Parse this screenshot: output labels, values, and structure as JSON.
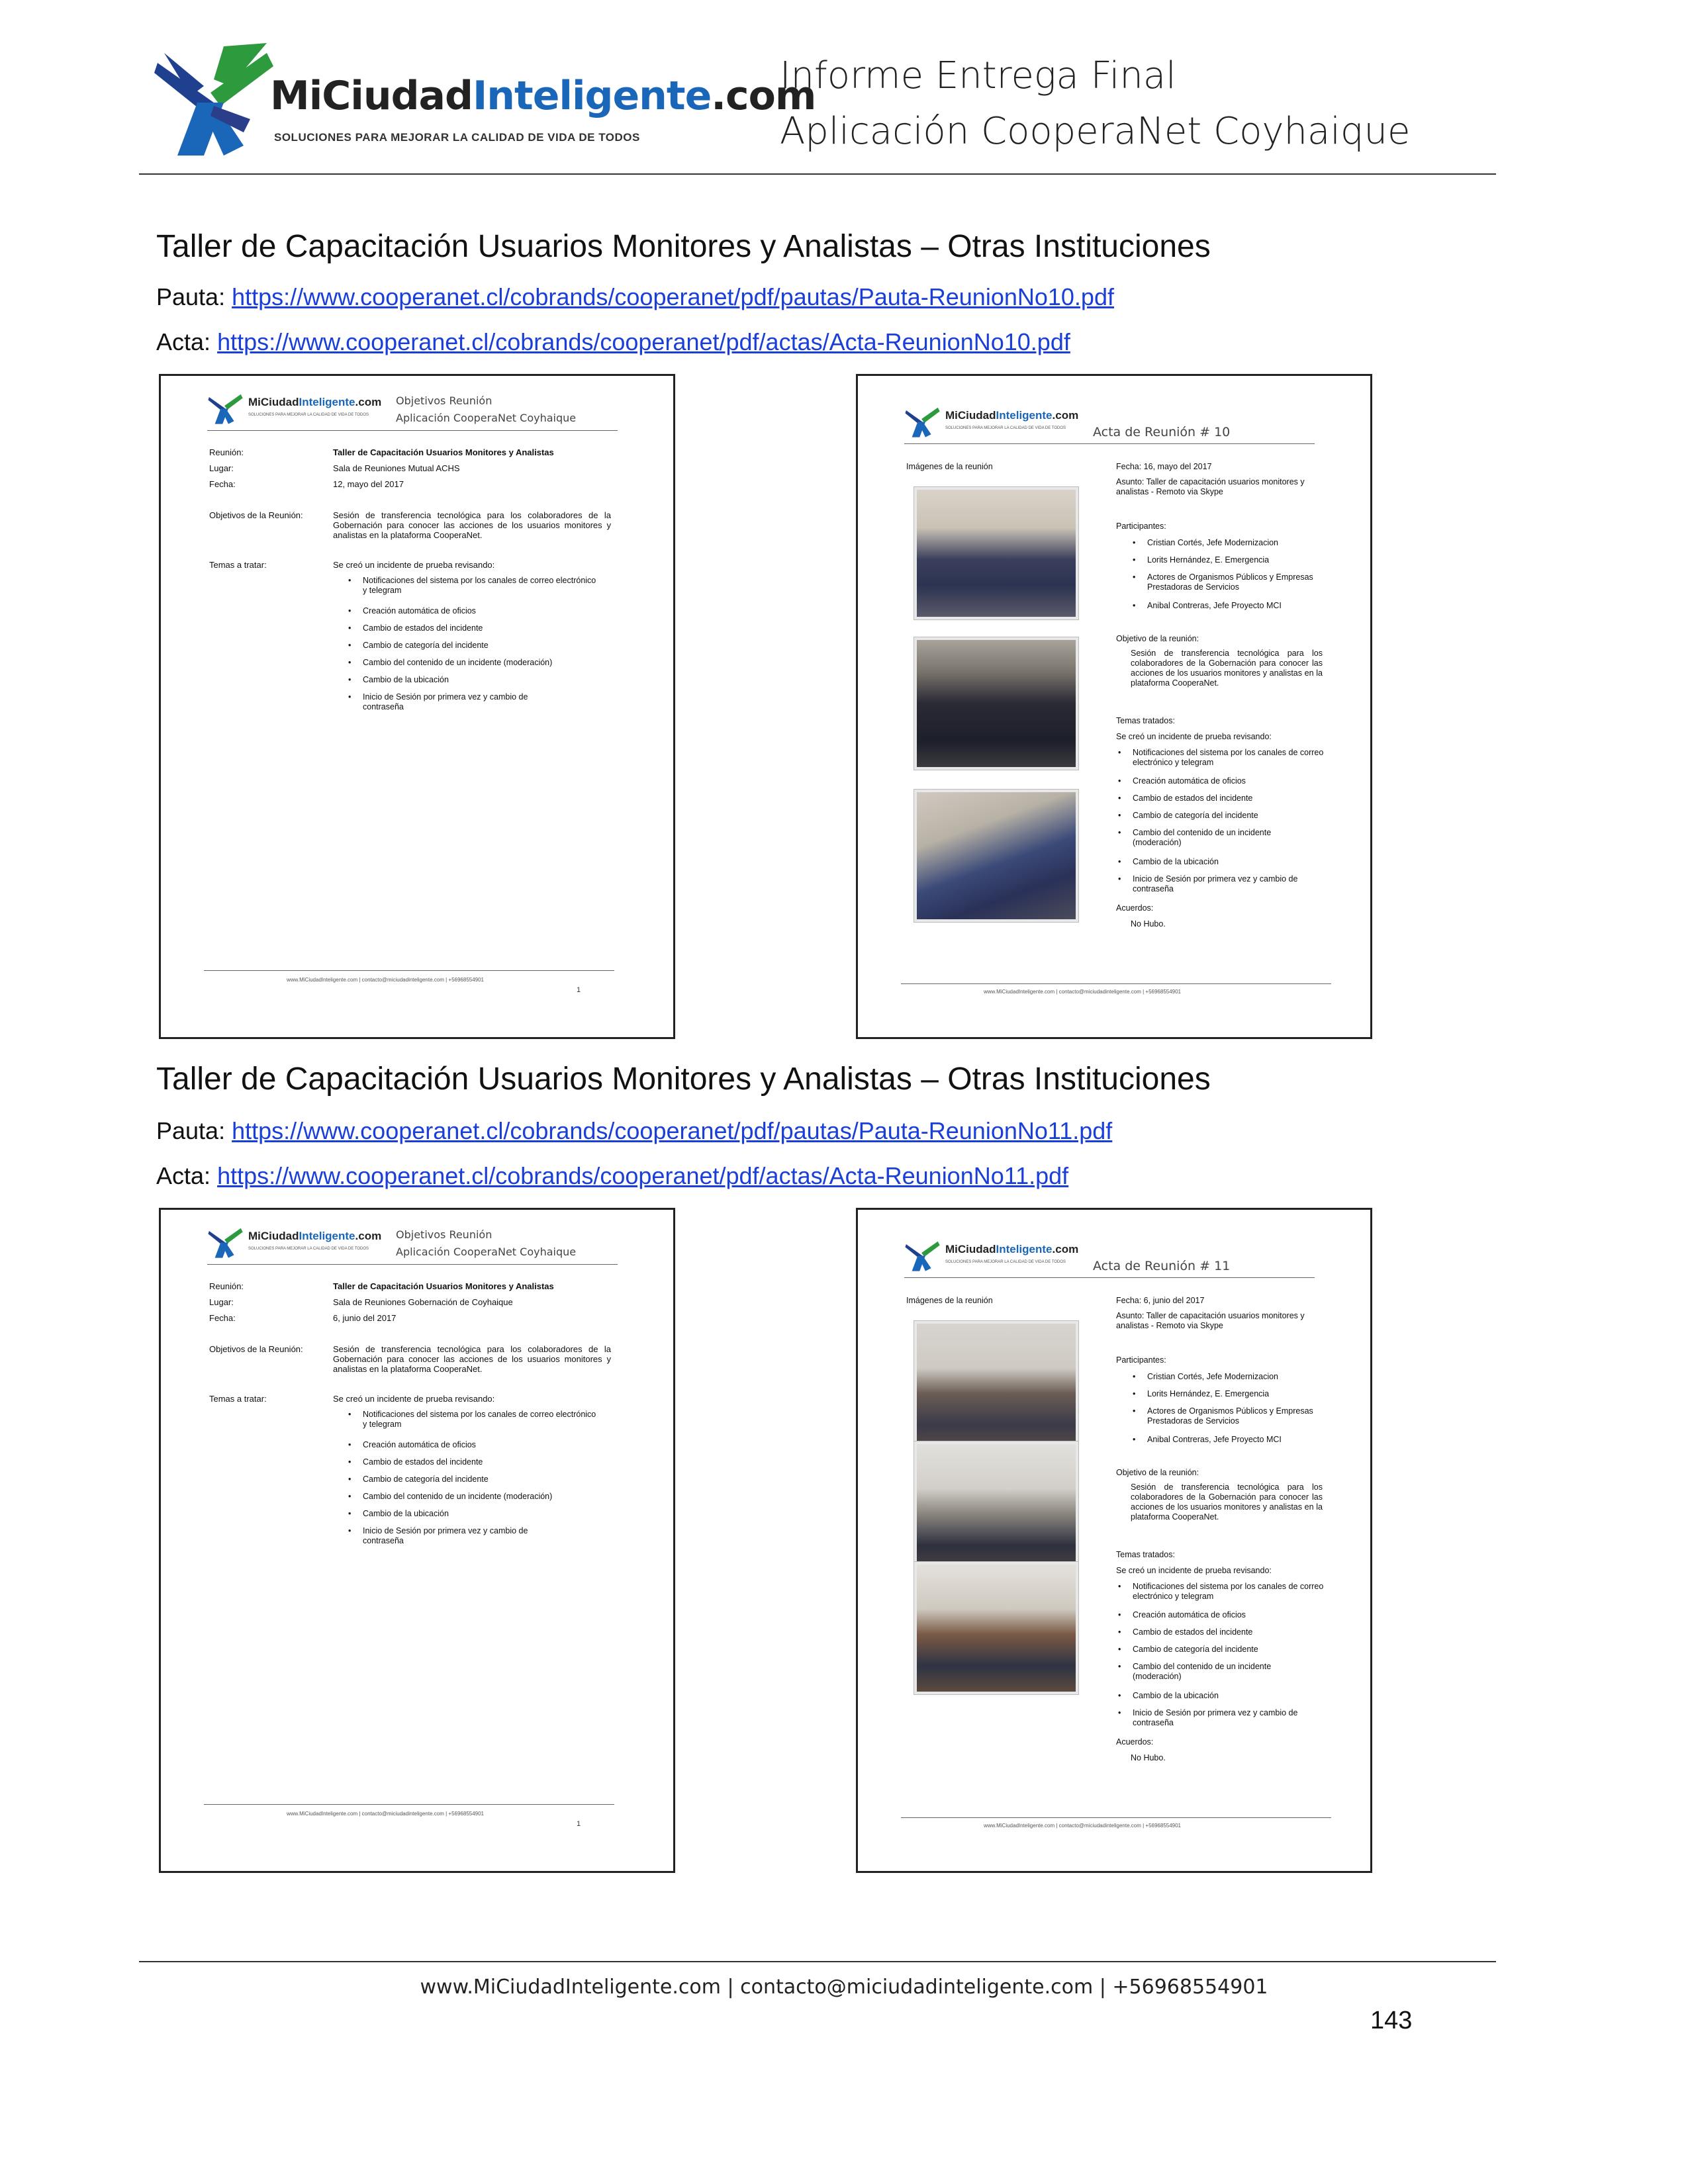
{
  "header": {
    "logo_text_mi": "MiCiudad",
    "logo_text_intel": "Inteligente",
    "logo_text_com": ".com",
    "logo_tagline": "SOLUCIONES PARA MEJORAR LA CALIDAD DE VIDA DE TODOS",
    "title_line1": "Informe Entrega Final",
    "title_line2": "Aplicación CooperaNet Coyhaique"
  },
  "sections": [
    {
      "title": "Taller de Capacitación Usuarios Monitores y Analistas – Otras Instituciones",
      "pauta_label": "Pauta:",
      "pauta_url": "https://www.cooperanet.cl/cobrands/cooperanet/pdf/pautas/Pauta-ReunionNo10.pdf",
      "acta_label": "Acta:",
      "acta_url": "https://www.cooperanet.cl/cobrands/cooperanet/pdf/actas/Acta-ReunionNo10.pdf",
      "pauta_doc": {
        "head1": "Objetivos Reunión",
        "head2": "Aplicación CooperaNet Coyhaique",
        "reunion_label": "Reunión:",
        "reunion": "Taller de Capacitación Usuarios Monitores y Analistas",
        "lugar_label": "Lugar:",
        "lugar": "Sala de Reuniones Mutual ACHS",
        "fecha_label": "Fecha:",
        "fecha": "12, mayo del 2017",
        "objetivos_label": "Objetivos de la Reunión:",
        "objetivos": "Sesión de transferencia tecnológica para los colaboradores de la Gobernación para conocer las acciones de los usuarios monitores y analistas en la plataforma CooperaNet.",
        "temas_label": "Temas a tratar:",
        "temas_intro": "Se creó un incidente de prueba revisando:",
        "temas": [
          "Notificaciones del sistema por los canales de correo electrónico y telegram",
          "Creación automática de oficios",
          "Cambio de estados del incidente",
          "Cambio de categoría del incidente",
          "Cambio del contenido de un incidente (moderación)",
          "Cambio de la ubicación",
          "Inicio de Sesión por primera vez y cambio de contraseña"
        ],
        "footer": "www.MiCiudadInteligente.com | contacto@miciudadinteligente.com | +56968554901",
        "page": "1"
      },
      "acta_doc": {
        "head": "Acta de Reunión # 10",
        "imagenes_label": "Imágenes de la reunión",
        "fecha": "Fecha: 16, mayo del 2017",
        "asunto": "Asunto: Taller de capacitación usuarios monitores y analistas - Remoto via Skype",
        "participantes_label": "Participantes:",
        "participantes": [
          "Cristian Cortés, Jefe Modernizacion",
          "Lorits Hernández, E. Emergencia",
          "Actores de Organismos Públicos y Empresas Prestadoras de Servicios",
          "Anibal Contreras, Jefe Proyecto MCI"
        ],
        "objetivo_label": "Objetivo de la reunión:",
        "objetivo": "Sesión de transferencia tecnológica para los colaboradores de la Gobernación para conocer las acciones de los usuarios monitores y analistas en la plataforma CooperaNet.",
        "temas_label": "Temas tratados:",
        "temas_intro": "Se creó un incidente de prueba revisando:",
        "temas": [
          "Notificaciones del sistema por los canales de correo electrónico y telegram",
          "Creación automática de oficios",
          "Cambio de estados del incidente",
          "Cambio de categoría del incidente",
          "Cambio del contenido de un incidente (moderación)",
          "Cambio de la ubicación",
          "Inicio de Sesión por primera vez y cambio de contraseña"
        ],
        "acuerdos_label": "Acuerdos:",
        "acuerdos": "No Hubo.",
        "footer": "www.MiCiudadInteligente.com | contacto@miciudadinteligente.com | +56968554901"
      }
    },
    {
      "title": "Taller de Capacitación Usuarios Monitores y Analistas – Otras Instituciones",
      "pauta_label": "Pauta:",
      "pauta_url": "https://www.cooperanet.cl/cobrands/cooperanet/pdf/pautas/Pauta-ReunionNo11.pdf",
      "acta_label": "Acta:",
      "acta_url": "https://www.cooperanet.cl/cobrands/cooperanet/pdf/actas/Acta-ReunionNo11.pdf",
      "pauta_doc": {
        "head1": "Objetivos Reunión",
        "head2": "Aplicación CooperaNet Coyhaique",
        "reunion_label": "Reunión:",
        "reunion": "Taller de Capacitación Usuarios Monitores y Analistas",
        "lugar_label": "Lugar:",
        "lugar": "Sala de Reuniones Gobernación de Coyhaique",
        "fecha_label": "Fecha:",
        "fecha": "6, junio del 2017",
        "objetivos_label": "Objetivos de la Reunión:",
        "objetivos": "Sesión de transferencia tecnológica para los colaboradores de la Gobernación para conocer las acciones de los usuarios monitores y analistas en la plataforma CooperaNet.",
        "temas_label": "Temas a tratar:",
        "temas_intro": "Se creó un incidente de prueba revisando:",
        "temas": [
          "Notificaciones del sistema por los canales de correo electrónico y telegram",
          "Creación automática de oficios",
          "Cambio de estados del incidente",
          "Cambio de categoría del incidente",
          "Cambio del contenido de un incidente (moderación)",
          "Cambio de la ubicación",
          "Inicio de Sesión por primera vez y cambio de contraseña"
        ],
        "footer": "www.MiCiudadInteligente.com | contacto@miciudadinteligente.com | +56968554901",
        "page": "1"
      },
      "acta_doc": {
        "head": "Acta de Reunión # 11",
        "imagenes_label": "Imágenes de la reunión",
        "fecha": "Fecha: 6, junio del 2017",
        "asunto": "Asunto: Taller de capacitación usuarios monitores y analistas - Remoto via Skype",
        "participantes_label": "Participantes:",
        "participantes": [
          "Cristian Cortés, Jefe Modernizacion",
          "Lorits Hernández, E. Emergencia",
          "Actores de Organismos Públicos y Empresas Prestadoras de Servicios",
          "Anibal Contreras, Jefe Proyecto MCI"
        ],
        "objetivo_label": "Objetivo de la reunión:",
        "objetivo": "Sesión de transferencia tecnológica para los colaboradores de la Gobernación para conocer las acciones de los usuarios monitores y analistas en la plataforma CooperaNet.",
        "temas_label": "Temas tratados:",
        "temas_intro": "Se creó un incidente de prueba revisando:",
        "temas": [
          "Notificaciones del sistema por los canales de correo electrónico y telegram",
          "Creación automática de oficios",
          "Cambio de estados del incidente",
          "Cambio de categoría del incidente",
          "Cambio del contenido de un incidente (moderación)",
          "Cambio de la ubicación",
          "Inicio de Sesión por primera vez y cambio de contraseña"
        ],
        "acuerdos_label": "Acuerdos:",
        "acuerdos": "No Hubo.",
        "footer": "www.MiCiudadInteligente.com | contacto@miciudadinteligente.com | +56968554901"
      }
    }
  ],
  "footer": {
    "text": "www.MiCiudadInteligente.com | contacto@miciudadinteligente.com | +56968554901",
    "page_number": "143"
  },
  "colors": {
    "link": "#1a3fd9",
    "brand_blue": "#1a66b8",
    "brand_green": "#2e9a3e",
    "brand_navy": "#1f3f8f"
  }
}
